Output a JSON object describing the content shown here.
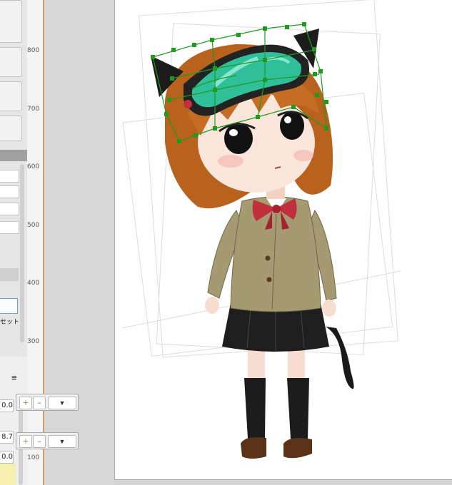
{
  "ruler": {
    "ticks": [
      "800",
      "700",
      "600",
      "500",
      "400",
      "300",
      "100"
    ]
  },
  "left_panel": {
    "preset_label": "セット",
    "menu_glyph": "≡"
  },
  "parameters": [
    {
      "value": "0.0"
    },
    {
      "value": "8.7"
    },
    {
      "value": "0.0"
    }
  ],
  "keyframe_toolbar": {
    "add_glyph": "＋",
    "delete_glyph": "−",
    "dropdown_glyph": "▼"
  },
  "icons": [
    "add-keyform-icon",
    "delete-keyform-icon",
    "dropdown-arrow-icon",
    "hamburger-menu-icon"
  ],
  "colors": {
    "deformer_handle": "#1f9a1f",
    "guide_line": "#e49a5a",
    "hair": "#b8621e",
    "jacket": "#a69a72",
    "goggle_lens": "#2fbf9a",
    "bow": "#c0303c"
  }
}
